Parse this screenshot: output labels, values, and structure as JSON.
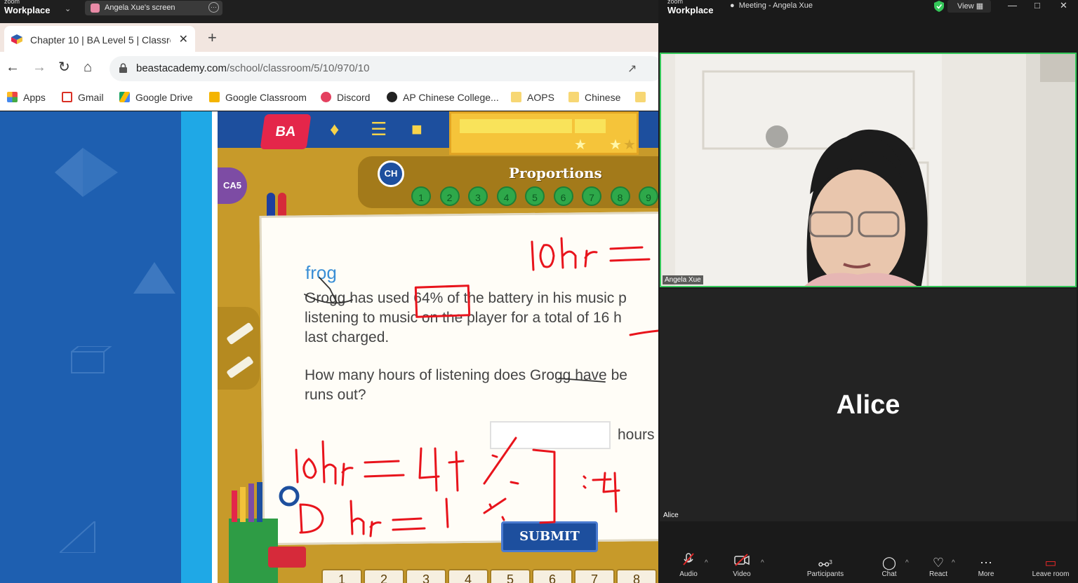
{
  "zoom_share_bar": {
    "logo_small": "zoom",
    "logo_big": "Workplace",
    "share_tab_label": "Angela Xue's screen"
  },
  "browser": {
    "tab_title": "Chapter 10 | BA Level 5 | Classro",
    "url_host": "beastacademy.com",
    "url_path": "/school/classroom/5/10/970/10",
    "bookmarks": [
      "Apps",
      "Gmail",
      "Google Drive",
      "Google Classroom",
      "Discord",
      "AP Chinese College...",
      "AOPS",
      "Chinese"
    ]
  },
  "game": {
    "logo": "BA",
    "chapter_badge": "CH",
    "level_badge": "CA5",
    "lesson_title": "Proportions",
    "problem_dots": [
      "1",
      "2",
      "3",
      "4",
      "5",
      "6",
      "7",
      "8",
      "9"
    ],
    "question": {
      "name_annotation": "frog",
      "line1": "Grogg has used 64% of the battery in his music p",
      "line2": "listening to music on the player for a total of 16 h",
      "line3": "last charged.",
      "line4": "How many hours of listening does Grogg have be",
      "line5": "runs out?"
    },
    "answer_placeholder": "",
    "answer_unit": "hours",
    "submit_label": "SUBMIT",
    "bottom_nav": [
      "1",
      "2",
      "3",
      "4",
      "5",
      "6",
      "7",
      "8"
    ]
  },
  "zoom_panel": {
    "logo_small": "zoom",
    "logo_big": "Workplace",
    "meeting_title": "Meeting - Angela Xue",
    "view_label": "View",
    "participant1_name": "Angela Xue",
    "participant2_name": "Alice",
    "participant2_big": "Alice",
    "toolbar": {
      "audio": "Audio",
      "video": "Video",
      "participants": "Participants",
      "participants_count": "3",
      "chat": "Chat",
      "react": "React",
      "more": "More",
      "leave": "Leave room"
    }
  },
  "colors": {
    "zoom_dark": "#1a1a1a",
    "active_speaker": "#34c759",
    "ba_blue": "#1d4f9e",
    "ba_gold": "#c79a2a",
    "ink_red": "#e8141c"
  }
}
